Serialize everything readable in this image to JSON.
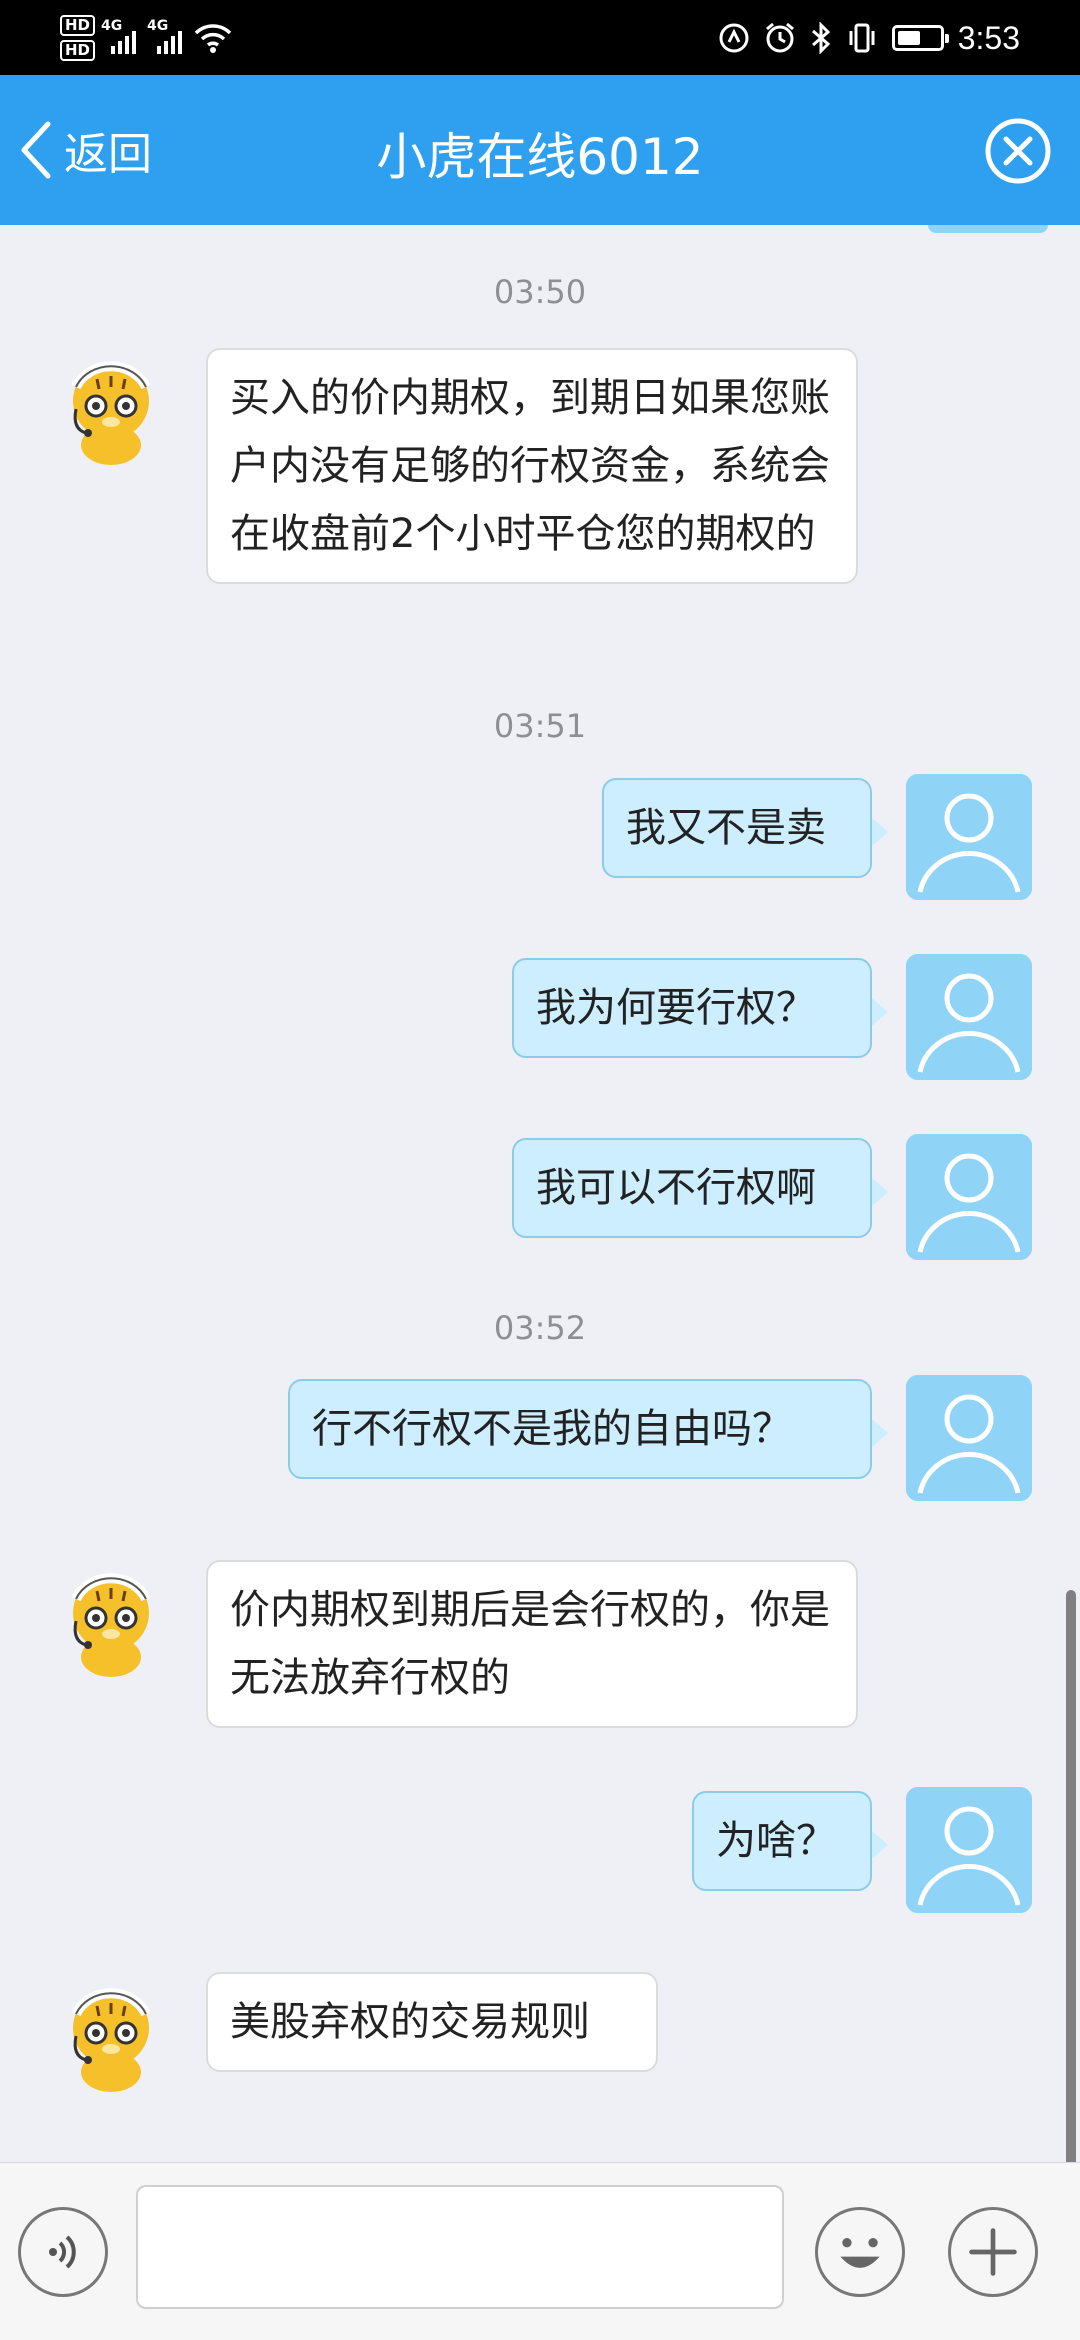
{
  "status_bar": {
    "hd1": "HD",
    "hd2": "HD",
    "net1": "4G",
    "net2": "4G",
    "time": "3:53",
    "battery_level": 0.55
  },
  "header": {
    "back_label": "返回",
    "title": "小虎在线6012"
  },
  "messages": {
    "t1": "03:50",
    "m1": "买入的价内期权，到期日如果您账户内没有足够的行权资金，系统会在收盘前2个小时平仓您的期权的",
    "t2": "03:51",
    "m2": "我又不是卖",
    "m3": "我为何要行权？",
    "m4": "我可以不行权啊",
    "t3": "03:52",
    "m5": "行不行权不是我的自由吗？",
    "m6": "价内期权到期后是会行权的，你是无法放弃行权的",
    "m7": "为啥？",
    "m8": "美股弃权的交易规则"
  },
  "input": {
    "value": "",
    "placeholder": ""
  },
  "colors": {
    "header_bg": "#2f9ff0",
    "chat_bg": "#eff0f5",
    "user_bubble": "#cdeeff",
    "user_avatar": "#8fd3f7",
    "agent_bubble": "#ffffff"
  },
  "icons": {
    "back": "chevron-left-icon",
    "close": "close-circle-icon",
    "agent_avatar": "tiger-avatar",
    "user_avatar": "user-avatar",
    "voice": "voice-icon",
    "emoji": "emoji-icon",
    "plus": "plus-icon"
  }
}
